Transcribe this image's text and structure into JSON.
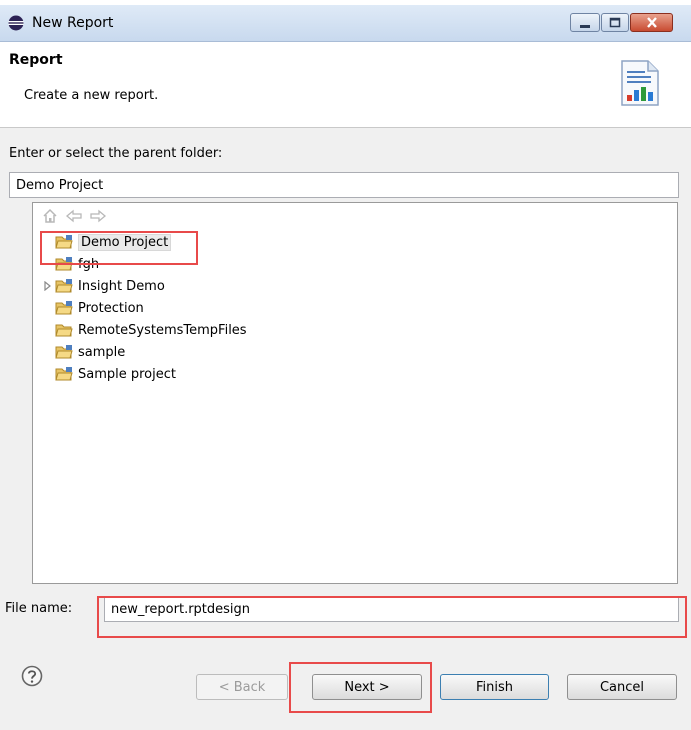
{
  "window": {
    "title": "New Report"
  },
  "header": {
    "title": "Report",
    "description": "Create a new report."
  },
  "folder": {
    "label": "Enter or select the parent folder:",
    "value": "Demo Project"
  },
  "tree": {
    "items": [
      {
        "label": "Demo Project",
        "selected": true,
        "expandable": false
      },
      {
        "label": "fgh",
        "selected": false,
        "expandable": false
      },
      {
        "label": "Insight Demo",
        "selected": false,
        "expandable": true
      },
      {
        "label": "Protection",
        "selected": false,
        "expandable": false
      },
      {
        "label": "RemoteSystemsTempFiles",
        "selected": false,
        "expandable": false
      },
      {
        "label": "sample",
        "selected": false,
        "expandable": false
      },
      {
        "label": "Sample project",
        "selected": false,
        "expandable": false
      }
    ]
  },
  "file": {
    "label": "File name:",
    "value": "new_report.rptdesign"
  },
  "buttons": {
    "back": "< Back",
    "next": "Next >",
    "finish": "Finish",
    "cancel": "Cancel"
  },
  "colors": {
    "highlight": "#e84a4a",
    "titlebar": "#c8d9ee",
    "dialog_bg": "#f0f0f0"
  },
  "icons": {
    "app": "eclipse-icon",
    "header": "report-wizard-icon",
    "home": "home-icon",
    "back": "back-arrow-icon",
    "forward": "forward-arrow-icon",
    "folder": "project-folder-icon",
    "help": "help-icon"
  }
}
